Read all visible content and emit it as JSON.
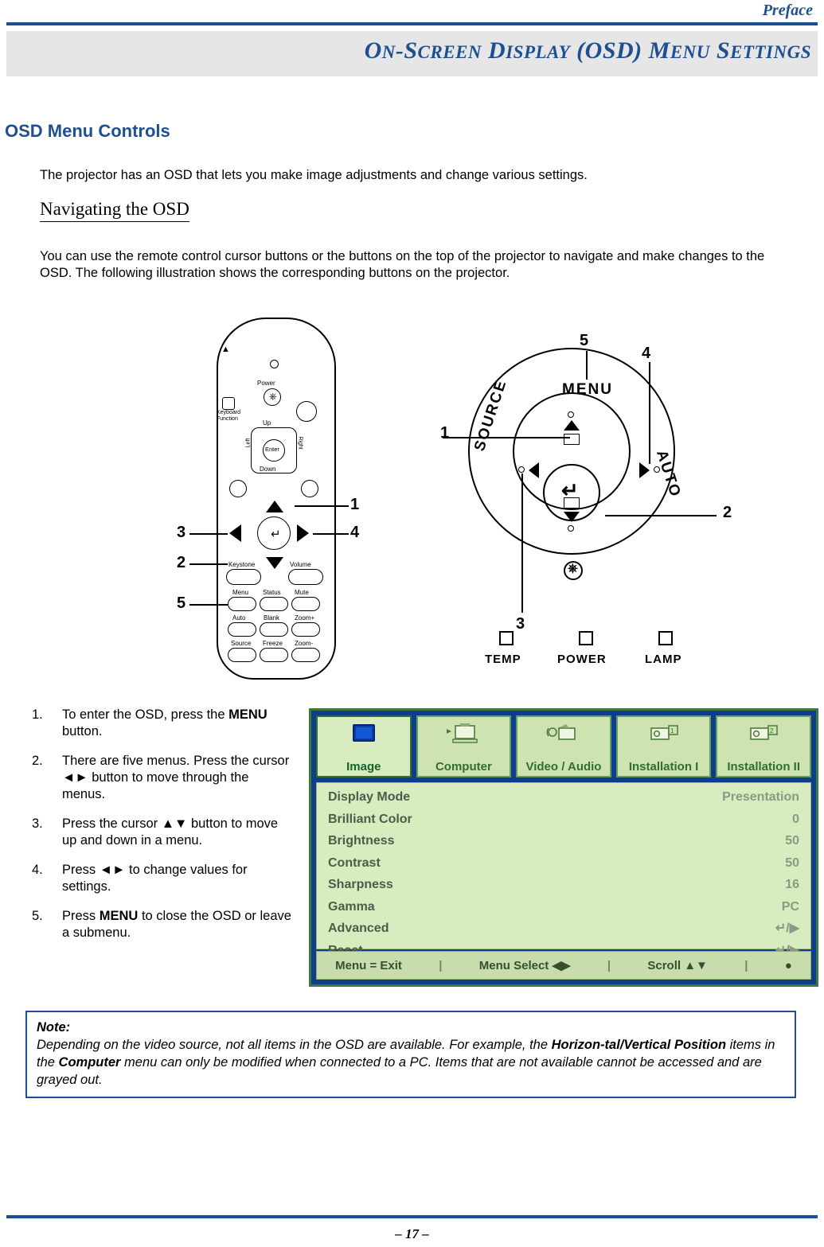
{
  "header": {
    "running_title": "Preface"
  },
  "banner": {
    "title_parts": [
      {
        "text": "O",
        "small": false
      },
      {
        "text": "N",
        "small": true
      },
      {
        "text": "-S",
        "small": false
      },
      {
        "text": "CREEN",
        "small": true
      },
      {
        "text": " D",
        "small": false
      },
      {
        "text": "ISPLAY",
        "small": true
      },
      {
        "text": " (OSD) M",
        "small": false
      },
      {
        "text": "ENU",
        "small": true
      },
      {
        "text": " S",
        "small": false
      },
      {
        "text": "ETTINGS",
        "small": true
      }
    ],
    "title_plain": "ON-SCREEN DISPLAY (OSD) MENU SETTINGS"
  },
  "section": {
    "heading": "OSD Menu Controls",
    "intro": "The projector has an OSD that lets you make image adjustments and change various settings.",
    "sub_heading": "Navigating the OSD",
    "body": "You can use the remote control cursor buttons or the buttons on the top of the projector to navigate and make changes to the OSD. The following illustration shows the corresponding buttons on the projector."
  },
  "remote": {
    "labels": {
      "power": "Power",
      "keyboard_function": "Keyboard\nFunction",
      "up": "Up",
      "down": "Down",
      "left": "Left",
      "right": "Right",
      "enter": "Enter",
      "keystone": "Keystone",
      "volume": "Volume",
      "menu": "Menu",
      "status": "Status",
      "mute": "Mute",
      "auto": "Auto",
      "blank": "Blank",
      "zoom_plus": "Zoom+",
      "source": "Source",
      "freeze": "Freeze",
      "zoom_minus": "Zoom-"
    },
    "callouts": [
      "1",
      "2",
      "3",
      "4",
      "5"
    ]
  },
  "keypad": {
    "menu": "MENU",
    "source": "SOURCE",
    "auto": "AUTO",
    "callouts": [
      "1",
      "2",
      "3",
      "4",
      "5"
    ],
    "indicators": [
      "TEMP",
      "POWER",
      "LAMP"
    ]
  },
  "steps": [
    {
      "num": "1.",
      "html": "To enter the OSD, press the <b>MENU</b> button."
    },
    {
      "num": "2.",
      "html": "There are five menus. Press the cursor ◄► button to move through the menus."
    },
    {
      "num": "3.",
      "html": "Press the cursor ▲▼ button to move up and down in a menu."
    },
    {
      "num": "4.",
      "html": "Press ◄► to change values for settings."
    },
    {
      "num": "5.",
      "html": "Press <b>MENU</b> to close the OSD or leave a submenu."
    }
  ],
  "osd": {
    "tabs": [
      {
        "label": "Image",
        "icon": "image-icon",
        "active": true
      },
      {
        "label": "Computer",
        "icon": "computer-icon",
        "active": false
      },
      {
        "label": "Video / Audio",
        "icon": "video-audio-icon",
        "active": false
      },
      {
        "label": "Installation I",
        "icon": "installation-1-icon",
        "active": false
      },
      {
        "label": "Installation II",
        "icon": "installation-2-icon",
        "active": false
      }
    ],
    "rows": [
      {
        "label": "Display Mode",
        "value": "Presentation"
      },
      {
        "label": "Brilliant Color",
        "value": "0"
      },
      {
        "label": "Brightness",
        "value": "50"
      },
      {
        "label": "Contrast",
        "value": "50"
      },
      {
        "label": "Sharpness",
        "value": "16"
      },
      {
        "label": "Gamma",
        "value": "PC"
      },
      {
        "label": "Advanced",
        "value": "↵/▶"
      },
      {
        "label": "Reset",
        "value": "↵/▶"
      }
    ],
    "footer": {
      "exit": "Menu = Exit",
      "select": "Menu Select ◀▶",
      "scroll": "Scroll ▲▼",
      "bulb": "●"
    }
  },
  "note": {
    "title": "Note:",
    "line_html": "Depending on the video source, not all items in the OSD are available. For example, the <b>Horizon-tal/Vertical Position</b> items in the <b>Computer</b> menu can only be modified when connected to a PC. Items that are not available cannot be accessed and are grayed out."
  },
  "footer": {
    "page_number": "– 17 –"
  },
  "colors": {
    "accent": "#1d4f91",
    "osd_border": "#3a7a3a",
    "osd_bg": "#d8ecc0",
    "osd_blue": "#0f3d8c"
  }
}
